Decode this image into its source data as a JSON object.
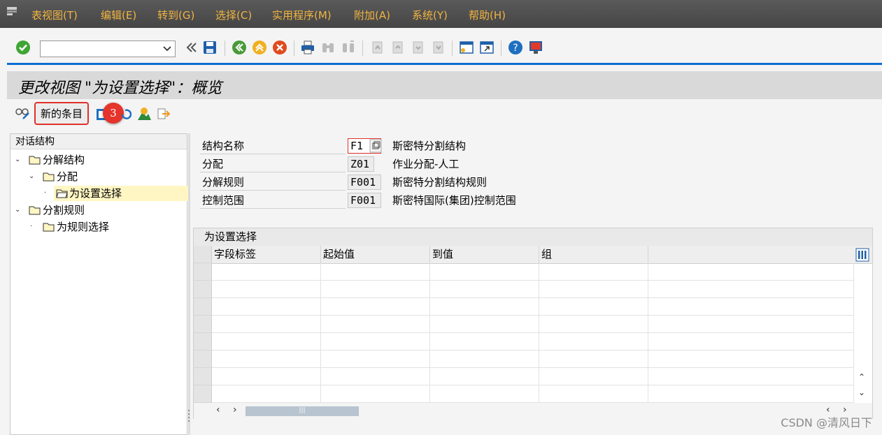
{
  "menubar": {
    "items": [
      "表视图(T)",
      "编辑(E)",
      "转到(G)",
      "选择(C)",
      "实用程序(M)",
      "附加(A)",
      "系统(Y)",
      "帮助(H)"
    ]
  },
  "toolbar": {
    "command_value": ""
  },
  "title": "更改视图 \"为设置选择\"：概览",
  "app_toolbar": {
    "new_entry_label": "新的条目",
    "step_badge": "3"
  },
  "tree": {
    "header": "对话结构",
    "nodes": [
      {
        "label": "分解结构"
      },
      {
        "label": "分配"
      },
      {
        "label": "为设置选择"
      },
      {
        "label": "分割规则"
      },
      {
        "label": "为规则选择"
      }
    ]
  },
  "fields": [
    {
      "label": "结构名称",
      "value": "F1",
      "desc": "斯密特分割结构"
    },
    {
      "label": "分配",
      "value": "Z01",
      "desc": "作业分配-人工"
    },
    {
      "label": "分解规则",
      "value": "F001",
      "desc": "斯密特分割结构规则"
    },
    {
      "label": "控制范围",
      "value": "F001",
      "desc": "斯密特国际(集团)控制范围"
    }
  ],
  "grid": {
    "title": "为设置选择",
    "columns": [
      "字段标签",
      "起始值",
      "到值",
      "组"
    ],
    "scroll_thumb": "|||"
  },
  "watermark": "CSDN @清风日下",
  "colors": {
    "menubar_text": "#f2b440",
    "accent_blue": "#0a6ed1",
    "highlight_red": "#e0302a",
    "selected_node": "#fff6c4"
  }
}
